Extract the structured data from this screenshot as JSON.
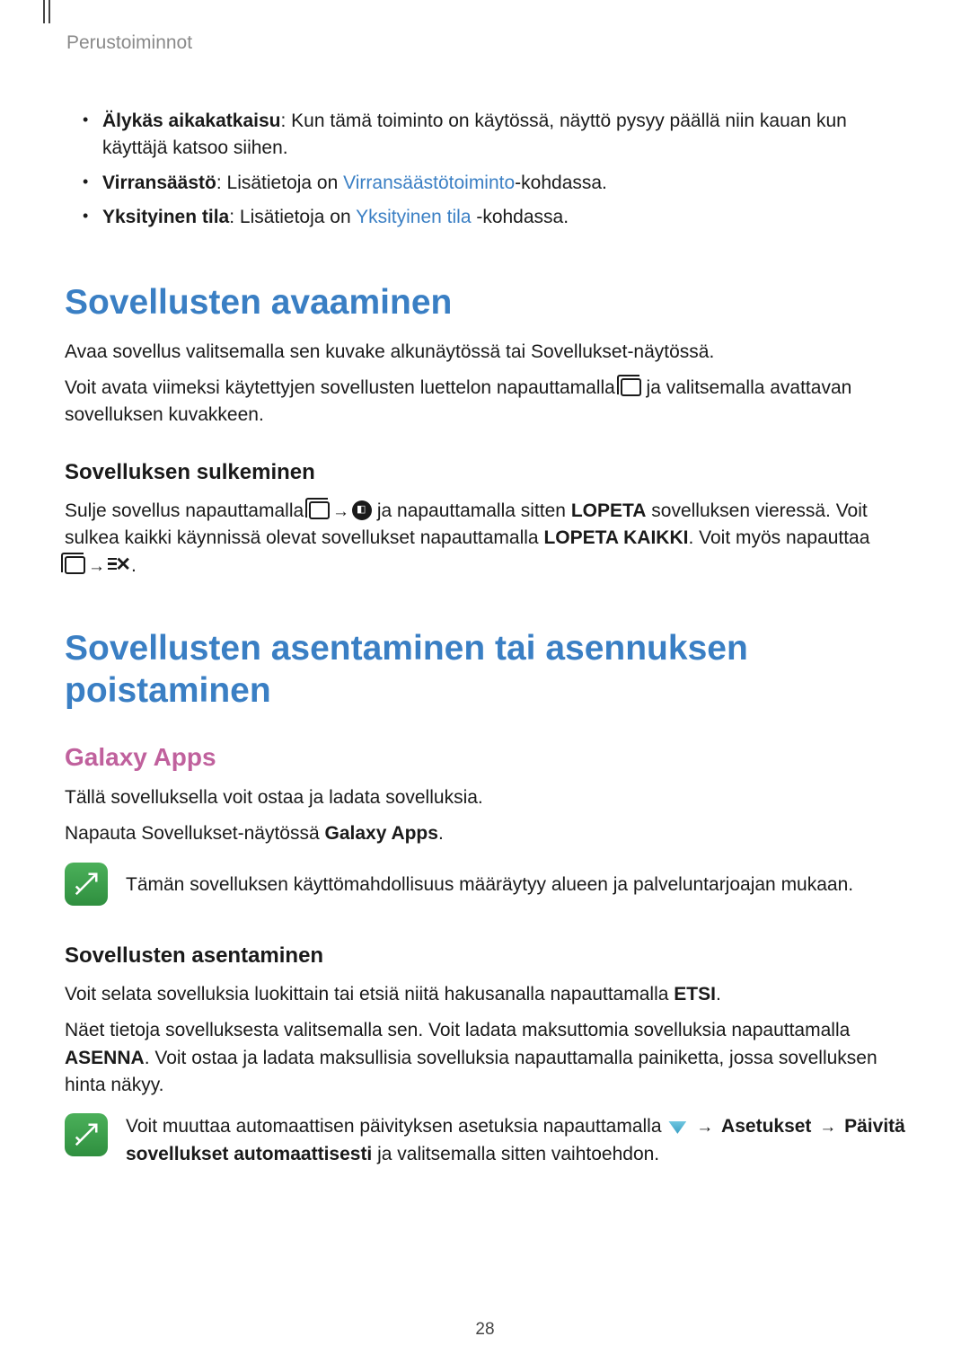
{
  "breadcrumb": "Perustoiminnot",
  "bullets": {
    "b1_bold": "Älykäs aikakatkaisu",
    "b1_text": ": Kun tämä toiminto on käytössä, näyttö pysyy päällä niin kauan kun käyttäjä katsoo siihen.",
    "b2_bold": "Virransäästö",
    "b2_text_a": ": Lisätietoja on ",
    "b2_link": "Virransäästötoiminto",
    "b2_text_b": "-kohdassa.",
    "b3_bold": "Yksityinen tila",
    "b3_text_a": ": Lisätietoja on ",
    "b3_link": "Yksityinen tila",
    "b3_text_b": " -kohdassa."
  },
  "section1": {
    "h1": "Sovellusten avaaminen",
    "p1": "Avaa sovellus valitsemalla sen kuvake alkunäytössä tai Sovellukset-näytössä.",
    "p2_a": "Voit avata viimeksi käytettyjen sovellusten luettelon napauttamalla ",
    "p2_b": " ja valitsemalla avattavan sovelluksen kuvakkeen.",
    "h3": "Sovelluksen sulkeminen",
    "p3_a": "Sulje sovellus napauttamalla ",
    "p3_b": " ja napauttamalla sitten ",
    "p3_bold1": "LOPETA",
    "p3_c": " sovelluksen vieressä. Voit sulkea kaikki käynnissä olevat sovellukset napauttamalla ",
    "p3_bold2": "LOPETA KAIKKI",
    "p3_d": ". Voit myös napauttaa "
  },
  "section2": {
    "h1": "Sovellusten asentaminen tai asennuksen poistaminen",
    "h2": "Galaxy Apps",
    "p1": "Tällä sovelluksella voit ostaa ja ladata sovelluksia.",
    "p2_a": "Napauta Sovellukset-näytössä ",
    "p2_bold": "Galaxy Apps",
    "p2_b": ".",
    "note1": "Tämän sovelluksen käyttömahdollisuus määräytyy alueen ja palveluntarjoajan mukaan.",
    "h3": "Sovellusten asentaminen",
    "p3_a": "Voit selata sovelluksia luokittain tai etsiä niitä hakusanalla napauttamalla ",
    "p3_bold": "ETSI",
    "p3_b": ".",
    "p4_a": "Näet tietoja sovelluksesta valitsemalla sen. Voit ladata maksuttomia sovelluksia napauttamalla ",
    "p4_bold": "ASENNA",
    "p4_b": ". Voit ostaa ja ladata maksullisia sovelluksia napauttamalla painiketta, jossa sovelluksen hinta näkyy.",
    "note2_a": "Voit muuttaa automaattisen päivityksen asetuksia napauttamalla ",
    "note2_bold1": "Asetukset",
    "note2_bold2": "Päivitä sovellukset automaattisesti",
    "note2_b": " ja valitsemalla sitten vaihtoehdon."
  },
  "arrow": "→",
  "page_number": "28"
}
